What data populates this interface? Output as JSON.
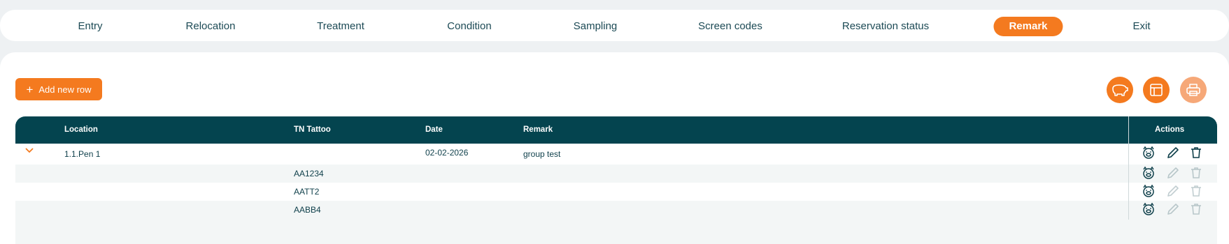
{
  "nav": {
    "items": [
      {
        "label": "Entry"
      },
      {
        "label": "Relocation"
      },
      {
        "label": "Treatment"
      },
      {
        "label": "Condition"
      },
      {
        "label": "Sampling"
      },
      {
        "label": "Screen codes"
      },
      {
        "label": "Reservation status"
      },
      {
        "label": "Remark",
        "active": true
      },
      {
        "label": "Exit"
      }
    ]
  },
  "toolbar": {
    "add_label": "Add new row",
    "add_icon": "plus",
    "right_buttons": [
      "pig-icon",
      "table-layout-icon",
      "print-icon"
    ]
  },
  "table": {
    "headers": {
      "location": "Location",
      "tattoo": "TN Tattoo",
      "date": "Date",
      "remark": "Remark",
      "actions": "Actions"
    },
    "group_row": {
      "location": "1.1.Pen 1",
      "tattoo": "",
      "date": "02-02-2026",
      "remark": "group test",
      "expanded": true
    },
    "child_rows": [
      {
        "tattoo": "AA1234"
      },
      {
        "tattoo": "AATT2"
      },
      {
        "tattoo": "AABB4"
      }
    ]
  },
  "colors": {
    "accent": "#f47a1f",
    "header_bg": "#04444f",
    "text": "#0e3f4a"
  }
}
